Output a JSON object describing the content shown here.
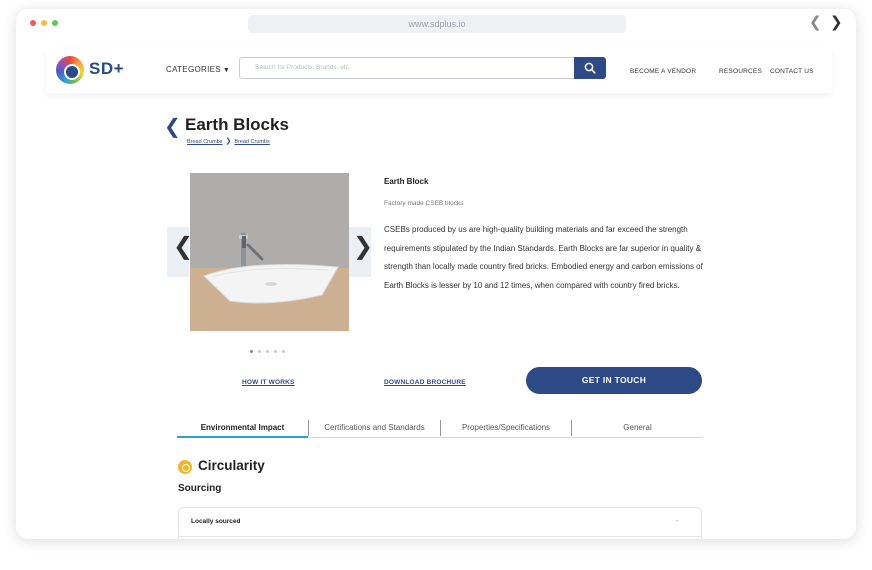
{
  "browser": {
    "url": "www.sdplus.io"
  },
  "header": {
    "logo_text": "SD+",
    "categories_label": "CATEGORIES",
    "search_placeholder": "Search for Products, Brands, etc",
    "links": [
      "BECOME A VENDOR",
      "RESOURCES",
      "CONTACT US"
    ]
  },
  "page": {
    "title": "Earth Blocks",
    "breadcrumbs": [
      "Bread Crumbs",
      "Bread Crumbs"
    ]
  },
  "product": {
    "name": "Earth Block",
    "subtitle": "Factory made CSEB blocks",
    "description": "CSEBs produced by us are high-quality building materials and far exceed the strength requirements stipulated by the Indian Standards. Earth Blocks are far superior in quality & strength than locally made country fired bricks. Embodied energy and carbon emissions of Earth Blocks is lesser by 10 and 12 times, when compared with country fired bricks.",
    "gallery_count": 5,
    "gallery_active": 0
  },
  "actions": {
    "how_it_works": "HOW IT WORKS",
    "download_brochure": "DOWNLOAD BROCHURE",
    "get_in_touch": "GET IN TOUCH"
  },
  "tabs": [
    {
      "label": "Environmental Impact",
      "active": true
    },
    {
      "label": "Certifications and Standards",
      "active": false
    },
    {
      "label": "Properties/Specifications",
      "active": false
    },
    {
      "label": "General",
      "active": false
    }
  ],
  "section": {
    "title": "Circularity",
    "subheading": "Sourcing",
    "accordion": [
      {
        "label": "Locally sourced",
        "toggle": "-"
      }
    ]
  },
  "colors": {
    "brand": "#2d4a86",
    "tab_underline": "#2f9fd8",
    "circularity_icon": "#f4b429"
  }
}
